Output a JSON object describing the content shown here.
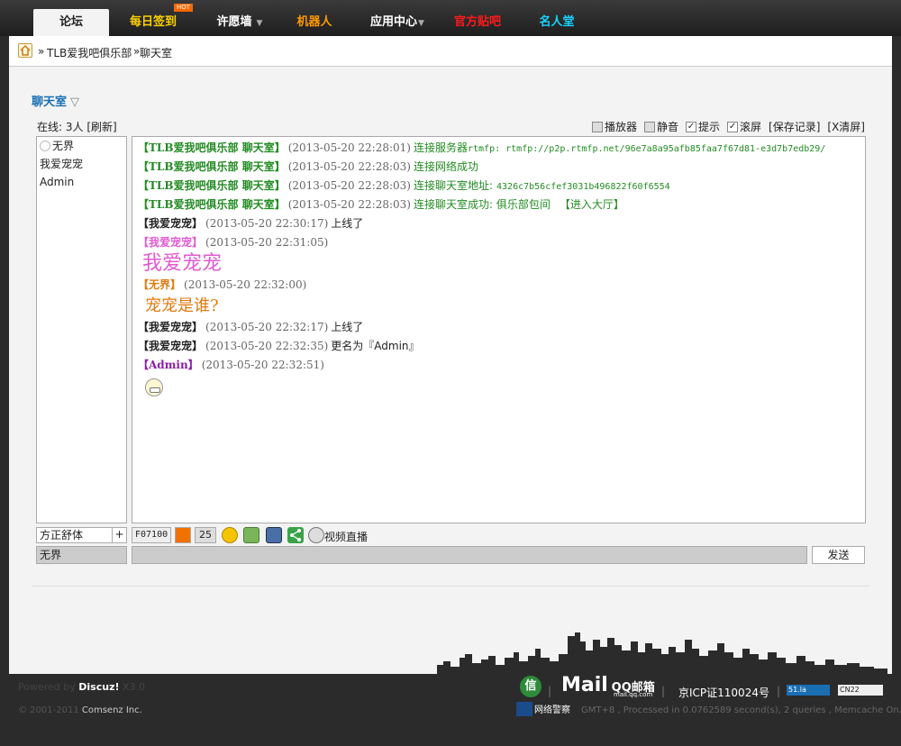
{
  "nav": {
    "items": [
      {
        "label": "论坛",
        "active": true
      },
      {
        "label": "每日签到",
        "badge": "HOT",
        "color": "#ffd000"
      },
      {
        "label": "许愿墙",
        "caret": "▼"
      },
      {
        "label": "机器人",
        "color": "#ff9900"
      },
      {
        "label": "应用中心",
        "caret": "▼"
      },
      {
        "label": "官方贴吧",
        "color": "#ff0000"
      },
      {
        "label": "名人堂",
        "color": "#00d0ff"
      }
    ]
  },
  "breadcrumb": {
    "sep": "»",
    "items": [
      "TLB爱我吧俱乐部",
      "聊天室"
    ]
  },
  "room": {
    "title": "聊天室",
    "toggle": "▽"
  },
  "online": {
    "text": "在线: 3人",
    "refresh": "[刷新]"
  },
  "toolbar": {
    "player": "播放器",
    "mute": "静音",
    "notify": "提示",
    "scroll": "滚屏",
    "save": "[保存记录]",
    "clear": "[X清屏]"
  },
  "users": [
    "无界",
    "我爱宠宠",
    "Admin"
  ],
  "messages": [
    {
      "sender": "【TLB爱我吧俱乐部 聊天室】",
      "time": "(2013-05-20 22:28:01)",
      "text": "连接服务器",
      "extra": "rtmfp: rtmfp://p2p.rtmfp.net/96e7a8a95afb85faa7f67d81-e3d7b7edb29/"
    },
    {
      "sender": "【TLB爱我吧俱乐部 聊天室】",
      "time": "(2013-05-20 22:28:03)",
      "text": "连接网络成功"
    },
    {
      "sender": "【TLB爱我吧俱乐部 聊天室】",
      "time": "(2013-05-20 22:28:03)",
      "text": "连接聊天室地址:",
      "extra": "4326c7b56cfef3031b496822f60f6554"
    },
    {
      "sender": "【TLB爱我吧俱乐部 聊天室】",
      "time": "(2013-05-20 22:28:03)",
      "text": "连接聊天室成功: 俱乐部包间",
      "link": "【进入大厅】"
    },
    {
      "sender": "【我爱宠宠】",
      "time": "(2013-05-20 22:30:17)",
      "text": "上线了"
    },
    {
      "sender": "【我爱宠宠】",
      "time": "(2013-05-20 22:31:05)",
      "big": "我爱宠宠"
    },
    {
      "sender": "【无界】",
      "time": "(2013-05-20 22:32:00)",
      "big": "宠宠是谁?"
    },
    {
      "sender": "【我爱宠宠】",
      "time": "(2013-05-20 22:32:17)",
      "text": "上线了"
    },
    {
      "sender": "【我爱宠宠】",
      "time": "(2013-05-20 22:32:35)",
      "text": "更名为『Admin』"
    },
    {
      "sender": "【Admin】",
      "time": "(2013-05-20 22:32:51)"
    }
  ],
  "input": {
    "font": "方正舒体",
    "font_add": "+",
    "color_value": "F07100",
    "size_value": "25",
    "video_label": "视频直播",
    "nickname": "无界",
    "send": "发送"
  },
  "footer": {
    "powered_prefix": "Powered by",
    "powered_brand": "Discuz!",
    "powered_version": "X3.0",
    "copyright_prefix": "© 2001-2011",
    "copyright_company": "Comsenz Inc.",
    "icp": "京ICP证110024号",
    "la51": "51.la",
    "cnzz": "CN22",
    "xin": "信",
    "mail_word": "Mail",
    "mail_qq": "QQ邮箱",
    "mail_site": "mail.qq.com",
    "police": "网络警察",
    "gmt": "GMT+8 , Processed in 0.0762589 second(s), 2 queries , Memcache On."
  },
  "colors": {
    "system_green": "#228b22",
    "accent_blue": "#1a6fb3",
    "swatch": "#f07100"
  }
}
